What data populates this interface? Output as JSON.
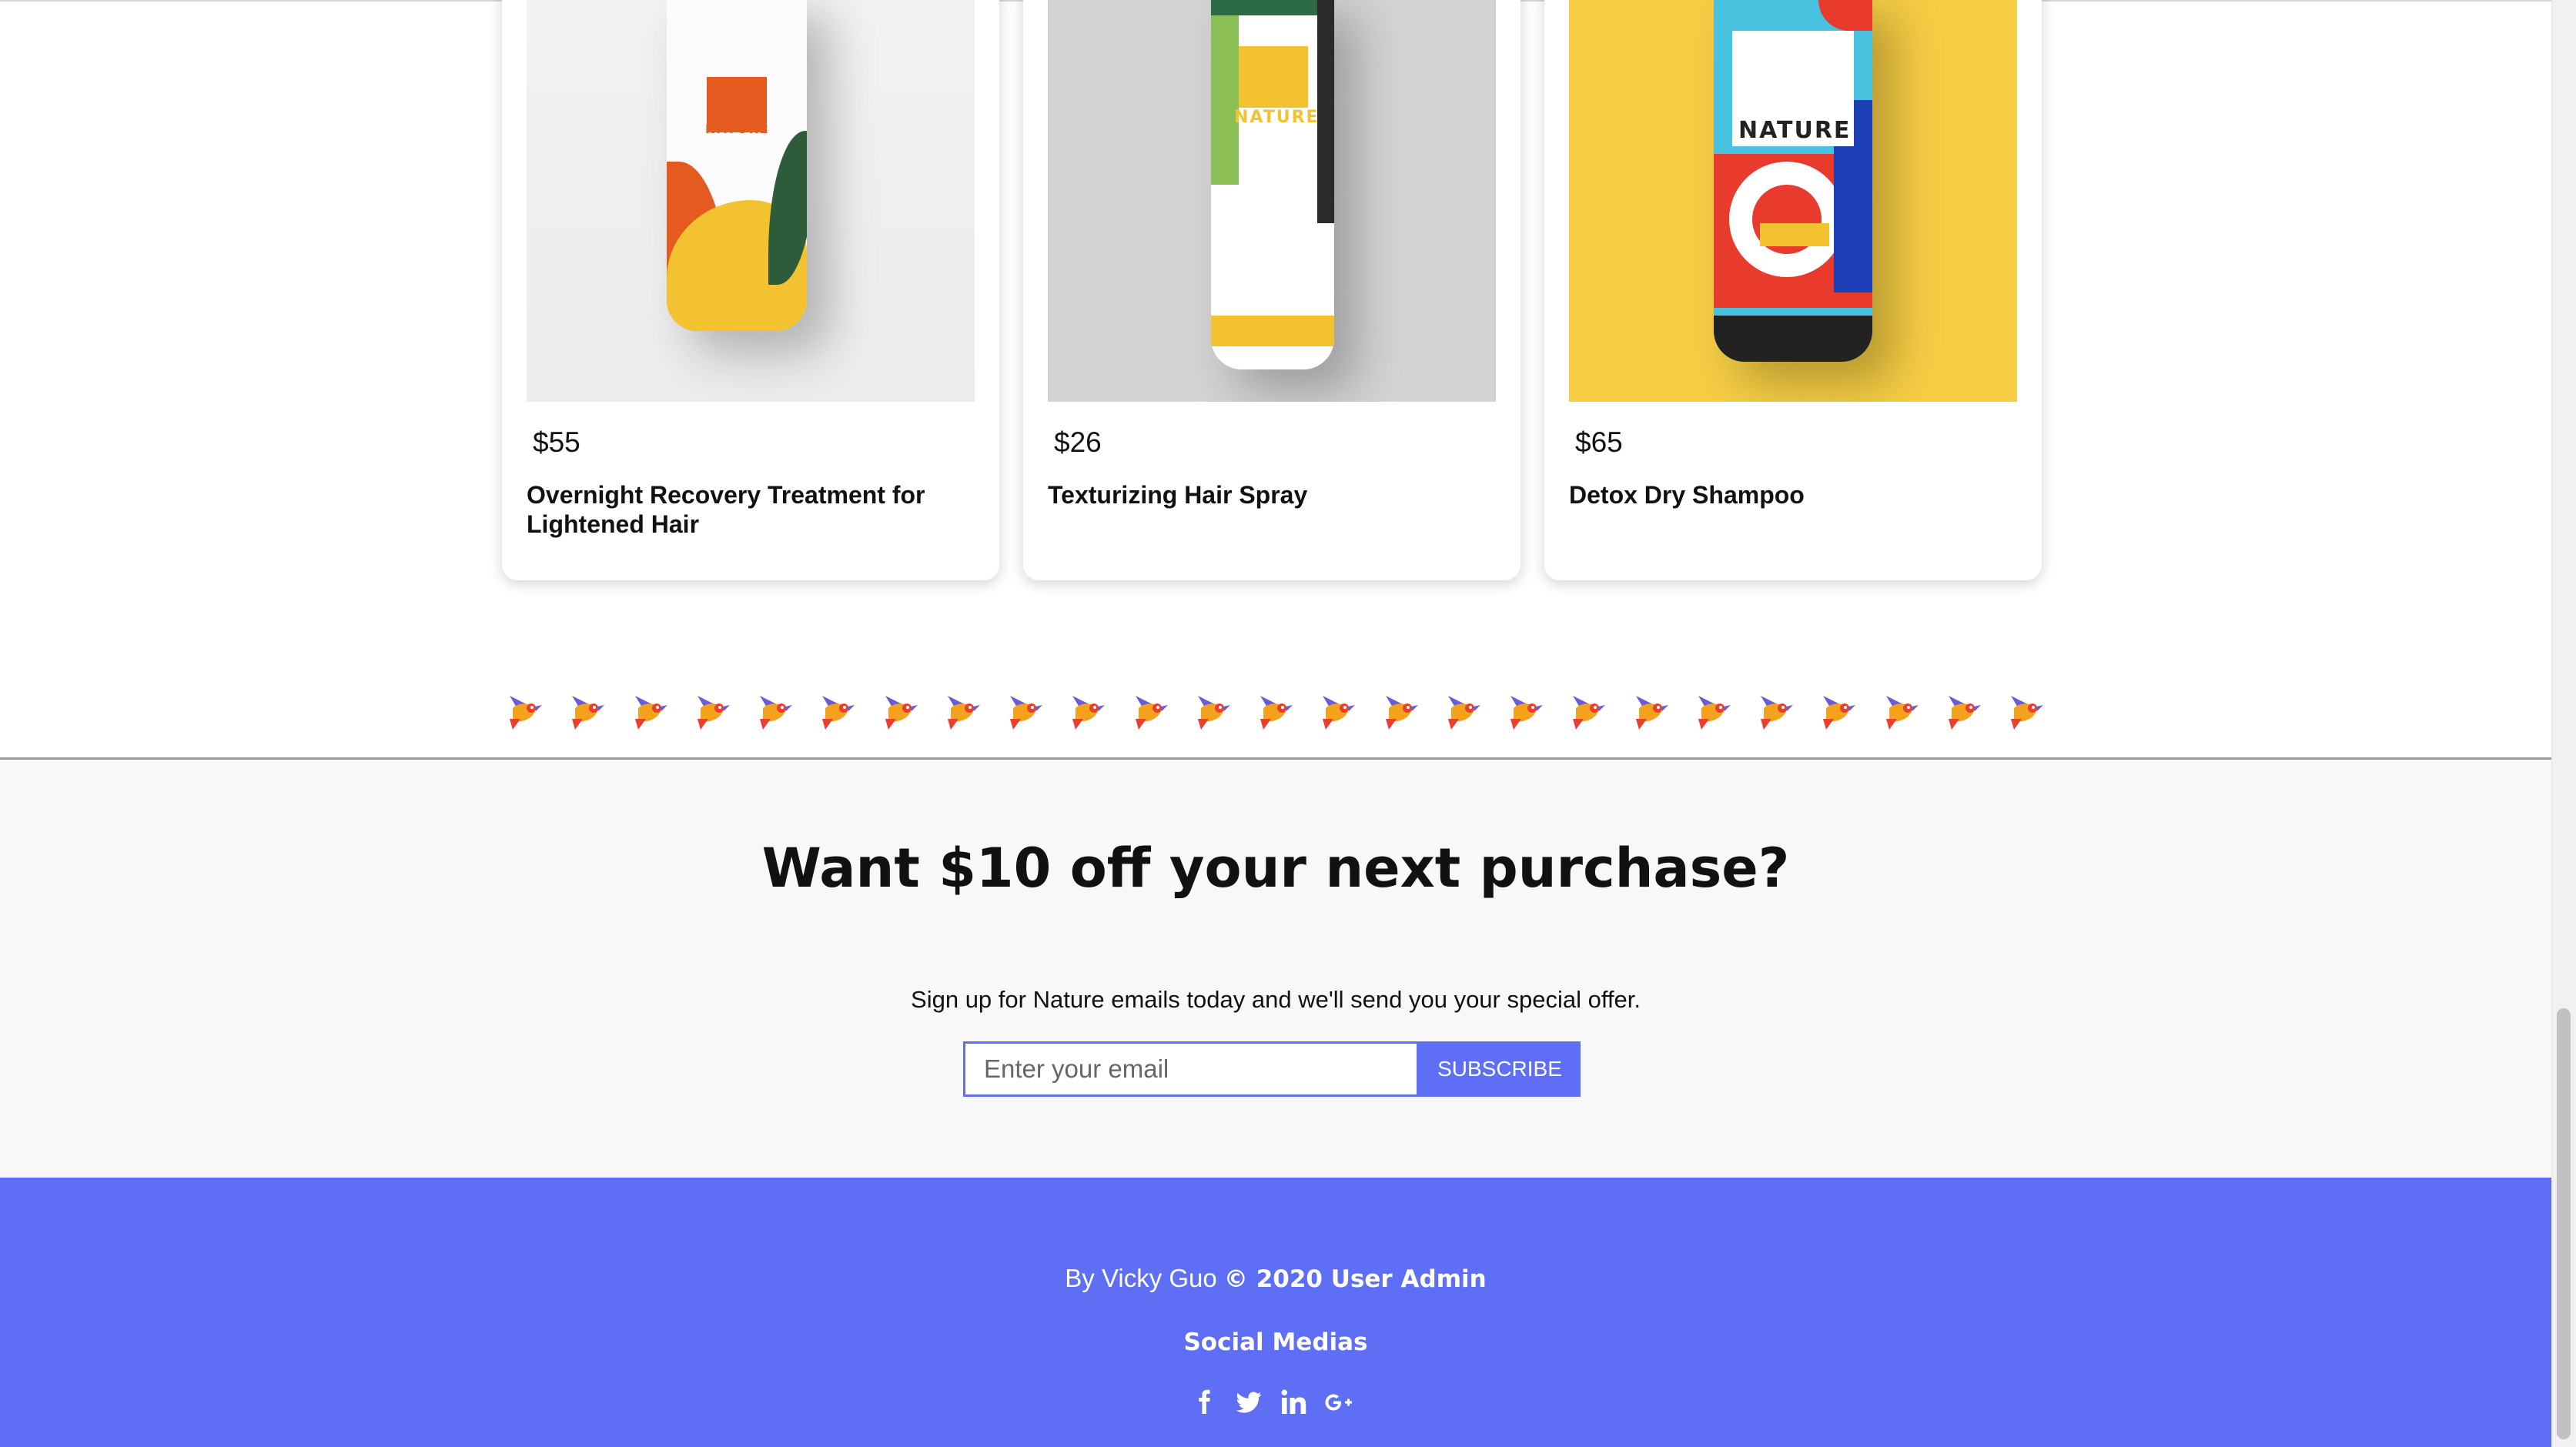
{
  "products": [
    {
      "price": "$55",
      "name": "Overnight Recovery Treatment for Lightened Hair",
      "brand": "NATURE"
    },
    {
      "price": "$26",
      "name": "Texturizing Hair Spray",
      "brand": "NATURE"
    },
    {
      "price": "$65",
      "name": "Detox Dry Shampoo",
      "brand": "NATURE"
    }
  ],
  "divider": {
    "icon": "bird-icon",
    "count": 25,
    "colors": [
      "#f4a11c",
      "#6b5bd6",
      "#e8402d"
    ]
  },
  "newsletter": {
    "title": "Want $10 off your next purchase?",
    "subtitle": "Sign up for Nature emails today and we'll send you your special offer.",
    "email_placeholder": "Enter your email",
    "email_value": "",
    "subscribe_label": "SUBSCRIBE"
  },
  "footer": {
    "credit_prefix": "By Vicky Guo",
    "credit_bold": "© 2020 User Admin",
    "social_title": "Social Medias",
    "social_icons": [
      "facebook-icon",
      "twitter-icon",
      "linkedin-icon",
      "google-plus-icon"
    ]
  },
  "colors": {
    "accent": "#5e6ef5",
    "newsletter_bg": "#f8f8f8"
  }
}
